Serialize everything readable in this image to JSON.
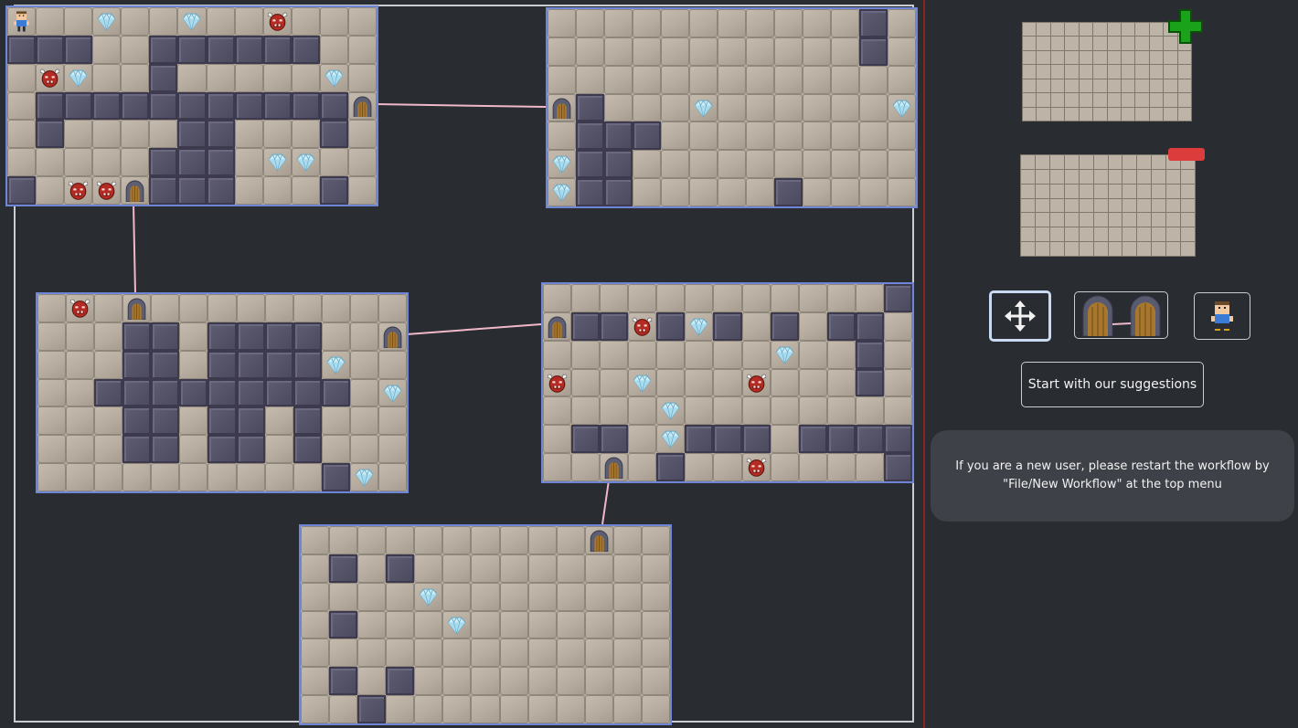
{
  "legend": {
    "f": "floor",
    "w": "wall",
    "p": "player",
    "m": "minotaur-enemy",
    "d": "treasure-diamond",
    "o": "arched-door"
  },
  "rooms": [
    {
      "id": "room-1",
      "cols": 13,
      "rows": 7,
      "grid": [
        "pffdffdffmfff",
        "wwwffwwwwwwff",
        "fmdffwfffffdf",
        "fwwwwwwwwwwwo",
        "fwffffwwfffwf",
        "fffffwwwfddff",
        "wfmmowwwfffwf"
      ]
    },
    {
      "id": "room-2",
      "cols": 13,
      "rows": 7,
      "grid": [
        "fffffffffffwf",
        "fffffffffffwf",
        "fffffffffffff",
        "owfffdffffffd",
        "fwwwfffffffff",
        "dwwffffffffff",
        "dwwfffffwffff"
      ]
    },
    {
      "id": "room-3",
      "cols": 13,
      "rows": 7,
      "grid": [
        "fmfofffffffff",
        "fffwwfwwwwffo",
        "fffwwfwwwwdff",
        "ffwwwwwwwwwfd",
        "fffwwfwwfwfff",
        "fffwwfwwfwfff",
        "ffffffffffwdf"
      ]
    },
    {
      "id": "room-4",
      "cols": 13,
      "rows": 7,
      "grid": [
        "ffffffffffffwf",
        "owwmwdwfwfwwff",
        "ffffffffdffwfff",
        "mffdfffmfffwf",
        "ffffdffffffff",
        "fwwfdwwwfwwww",
        "ffofwffmffffw"
      ]
    },
    {
      "id": "room-5",
      "cols": 13,
      "rows": 7,
      "grid": [
        "ffffffffffoff",
        "fwfwfffffffff",
        "ffffdffffffff",
        "fwfffdfffffff",
        "fffffffffffff",
        "fwfwfffffffff",
        "ffwffffffffff"
      ]
    }
  ],
  "links": [
    {
      "from": "room-1",
      "to": "room-2"
    },
    {
      "from": "room-1",
      "to": "room-3"
    },
    {
      "from": "room-3",
      "to": "room-4"
    },
    {
      "from": "room-4",
      "to": "room-5"
    }
  ],
  "panel": {
    "add_template": {
      "icon": "plus-icon",
      "cols": 12,
      "rows": 7
    },
    "remove_template": {
      "icon": "minus-icon",
      "cols": 12,
      "rows": 7
    },
    "tools": [
      {
        "id": "move",
        "icon": "move-arrows-icon",
        "active": true
      },
      {
        "id": "connect",
        "icon": "connect-doors-icon",
        "active": false
      },
      {
        "id": "player",
        "icon": "player-icon",
        "active": false
      }
    ],
    "suggest_label": "Start with our suggestions",
    "notice_text": "If you are a new user, please restart the workflow by \"File/New Workflow\" at the top menu"
  },
  "colors": {
    "floor": "#b8ae9f",
    "wall": "#514f63",
    "room_border": "#6f86d6",
    "link": "#f0b8c8",
    "accent_border": "#8d2222"
  }
}
